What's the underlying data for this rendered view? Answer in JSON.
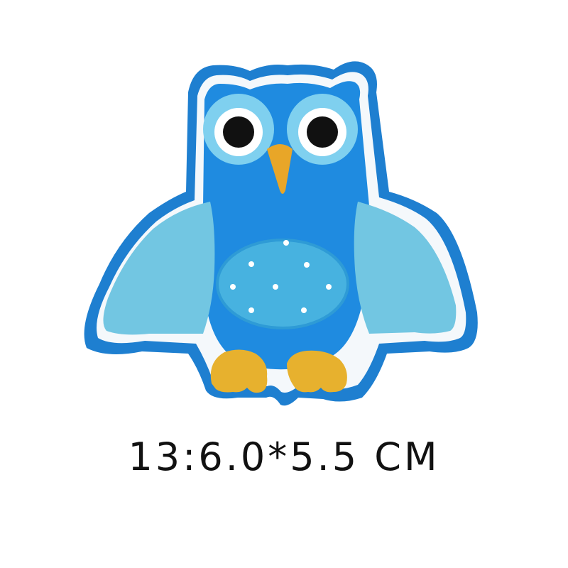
{
  "product": {
    "caption": "13:6.0*5.5 CM",
    "subject": "owl-patch"
  },
  "colors": {
    "background": "#ffffff",
    "border_blue": "#1e7fd0",
    "border_white": "#f4f8fb",
    "body_blue": "#1f8be0",
    "wing_light": "#72c6e2",
    "belly_light": "#47b2e0",
    "eye_ring": "#7fd0ef",
    "pupil": "#111111",
    "beak": "#e8a628",
    "feet": "#e7b12e",
    "text": "#111111"
  }
}
